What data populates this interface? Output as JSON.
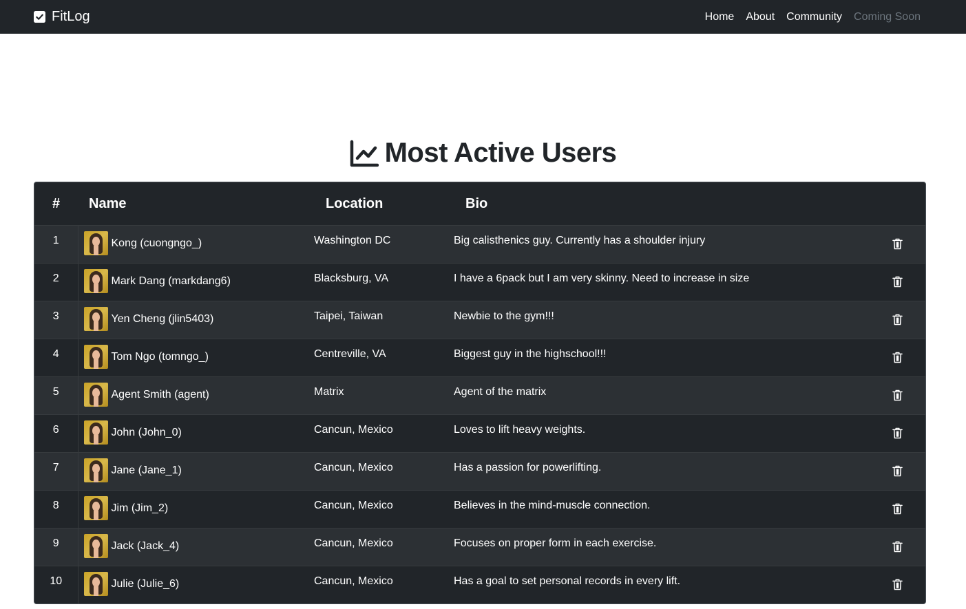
{
  "nav": {
    "brand": "FitLog",
    "links": [
      "Home",
      "About",
      "Community",
      "Coming Soon"
    ]
  },
  "page": {
    "title": "Most Active Users"
  },
  "table": {
    "headers": [
      "#",
      "Name",
      "Location",
      "Bio"
    ],
    "rows": [
      {
        "num": "1",
        "name": "Kong (cuongngo_)",
        "location": "Washington DC",
        "bio": "Big calisthenics guy. Currently has a shoulder injury"
      },
      {
        "num": "2",
        "name": "Mark Dang (markdang6)",
        "location": "Blacksburg, VA",
        "bio": "I have a 6pack but I am very skinny. Need to increase in size"
      },
      {
        "num": "3",
        "name": "Yen Cheng (jlin5403)",
        "location": "Taipei, Taiwan",
        "bio": "Newbie to the gym!!!"
      },
      {
        "num": "4",
        "name": "Tom Ngo (tomngo_)",
        "location": "Centreville, VA",
        "bio": "Biggest guy in the highschool!!!"
      },
      {
        "num": "5",
        "name": "Agent Smith (agent)",
        "location": "Matrix",
        "bio": "Agent of the matrix"
      },
      {
        "num": "6",
        "name": "John (John_0)",
        "location": "Cancun, Mexico",
        "bio": "Loves to lift heavy weights."
      },
      {
        "num": "7",
        "name": "Jane (Jane_1)",
        "location": "Cancun, Mexico",
        "bio": "Has a passion for powerlifting."
      },
      {
        "num": "8",
        "name": "Jim (Jim_2)",
        "location": "Cancun, Mexico",
        "bio": "Believes in the mind-muscle connection."
      },
      {
        "num": "9",
        "name": "Jack (Jack_4)",
        "location": "Cancun, Mexico",
        "bio": "Focuses on proper form in each exercise."
      },
      {
        "num": "10",
        "name": "Julie (Julie_6)",
        "location": "Cancun, Mexico",
        "bio": "Has a goal to set personal records in every lift."
      }
    ]
  },
  "icons": {
    "brand": "check-square-icon",
    "title": "line-chart-icon",
    "row_action": "trash-icon",
    "avatar": "user-photo"
  },
  "colors": {
    "navbar_bg": "#212529",
    "table_bg": "#212529",
    "table_stripe": "#2c3034",
    "muted_link": "#6c757d"
  }
}
